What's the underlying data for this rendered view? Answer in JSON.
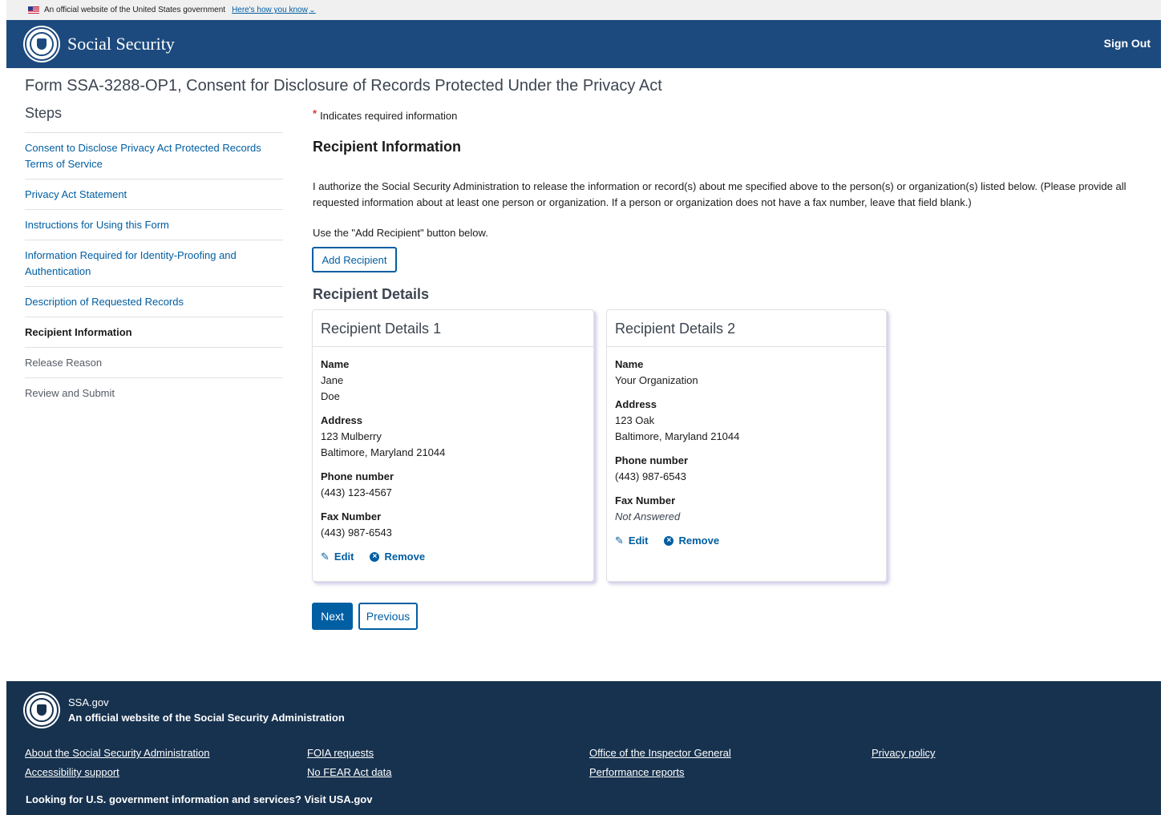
{
  "banner": {
    "official_text": "An official website of the United States government",
    "how_know": "Here's how you know"
  },
  "header": {
    "brand": "Social Security",
    "sign_out": "Sign Out"
  },
  "page_title": "Form SSA-3288-OP1, Consent for Disclosure of Records Protected Under the Privacy Act",
  "steps": {
    "heading": "Steps",
    "items": [
      {
        "label": "Consent to Disclose Privacy Act Protected Records Terms of Service",
        "state": "link"
      },
      {
        "label": "Privacy Act Statement",
        "state": "link"
      },
      {
        "label": "Instructions for Using this Form",
        "state": "link"
      },
      {
        "label": "Information Required for Identity-Proofing and Authentication",
        "state": "link"
      },
      {
        "label": "Description of Requested Records",
        "state": "link"
      },
      {
        "label": "Recipient Information",
        "state": "current"
      },
      {
        "label": "Release Reason",
        "state": "future"
      },
      {
        "label": "Review and Submit",
        "state": "future"
      }
    ]
  },
  "main": {
    "required_star": "*",
    "required_note": "Indicates required information",
    "section_title": "Recipient Information",
    "authorization_text": "I authorize the Social Security Administration to release the information or record(s) about me specified above to the person(s) or organization(s) listed below. (Please provide all requested information about at least one person or organization. If a person or organization does not have a fax number, leave that field blank.)",
    "use_text": "Use the \"Add Recipient\" button below.",
    "add_recipient_label": "Add Recipient",
    "details_title": "Recipient Details"
  },
  "labels": {
    "name": "Name",
    "address": "Address",
    "phone": "Phone number",
    "fax": "Fax Number",
    "edit": "Edit",
    "remove": "Remove"
  },
  "recipients": [
    {
      "title": "Recipient Details 1",
      "name_line1": "Jane",
      "name_line2": "Doe",
      "address_line1": "123 Mulberry",
      "address_line2": "Baltimore, Maryland 21044",
      "phone": "(443) 123-4567",
      "fax": "(443) 987-6543"
    },
    {
      "title": "Recipient Details 2",
      "name_line1": "Your Organization",
      "address_line1": "123 Oak",
      "address_line2": "Baltimore, Maryland 21044",
      "phone": "(443) 987-6543",
      "fax": "Not Answered"
    }
  ],
  "nav_buttons": {
    "next": "Next",
    "previous": "Previous"
  },
  "footer": {
    "site": "SSA.gov",
    "official": "An official website of the Social Security Administration",
    "links": [
      "About the Social Security Administration",
      "Accessibility support",
      "FOIA requests",
      "No FEAR Act data",
      "Office of the Inspector General",
      "Performance reports",
      "Privacy policy"
    ],
    "looking": "Looking for U.S. government information and services? Visit USA.gov"
  },
  "colors": {
    "header_bg": "#1c4a7e",
    "footer_bg": "#17324f",
    "link": "#005ea2",
    "required_star": "#d83933"
  }
}
